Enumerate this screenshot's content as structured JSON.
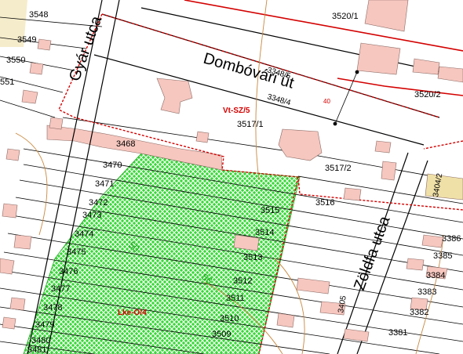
{
  "colors": {
    "building_fill": "#f6c7bf",
    "building_stroke": "#8a6a64",
    "zone_fill": "#3bd83b",
    "zone_red": "#d40000",
    "contour": "#c9883f",
    "green_text": "#1aa51a",
    "beige": "#efe0a8"
  },
  "roads": [
    {
      "key": "gyar",
      "name": "Gyár utca"
    },
    {
      "key": "dombovari",
      "name": "Dombóvári út"
    },
    {
      "key": "zoldfa",
      "name": "Zöldfa utca"
    }
  ],
  "zones": [
    {
      "key": "vt",
      "code": "Vt-SZ/5"
    },
    {
      "key": "lke",
      "code": "Lke-O/4"
    }
  ],
  "parcels_left": [
    "3548",
    "3549",
    "3550",
    "551",
    "3468",
    "3470",
    "3471",
    "3472",
    "3473",
    "3474",
    "3475",
    "3476",
    "3477",
    "3478",
    "3479",
    "3480",
    "3481"
  ],
  "parcels_mid": [
    "3348/5",
    "3348/4",
    "3517/1",
    "3517/2",
    "3516",
    "3515",
    "3514",
    "3513",
    "3512",
    "3511",
    "3510",
    "3509"
  ],
  "parcels_right": [
    "3520/1",
    "3520/2",
    "3404/2",
    "3386",
    "3385",
    "3384",
    "3383",
    "3382",
    "3381",
    "3405"
  ],
  "small_marks": [
    "40",
    "40"
  ],
  "green_numbers": [
    "50",
    "56"
  ]
}
